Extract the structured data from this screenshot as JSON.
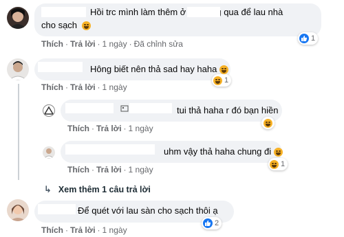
{
  "comments": [
    {
      "text": "Hồi trc mình làm thêm ở       . Khiêng qua để lau nhà",
      "text2": "cho sạch",
      "actions": [
        "Thích",
        "Trả lời",
        "1 ngày",
        "Đã chỉnh sửa"
      ],
      "reaction": {
        "type": "like-icon",
        "count": "1"
      }
    },
    {
      "text": "Hông biết nên thả sad hay haha",
      "actions": [
        "Thích",
        "Trả lời",
        "1 ngày"
      ],
      "reaction": {
        "type": "haha-icon",
        "count": "1"
      }
    },
    {
      "text": "tui thả haha r đó bạn hiền",
      "actions": [
        "Thích",
        "Trả lời",
        "1 ngày"
      ],
      "reaction": {
        "type": "haha-icon",
        "count": ""
      }
    },
    {
      "text": "uhm vậy thả haha chung đi",
      "actions": [
        "Thích",
        "Trả lời",
        "1 ngày"
      ],
      "reaction": {
        "type": "haha-icon",
        "count": "1"
      }
    },
    {
      "text": "Để quét với lau sàn cho sạch thôi ạ",
      "actions": [
        "Thích",
        "Trả lời",
        "1 ngày"
      ],
      "reaction": {
        "type": "like-icon",
        "count": "2"
      }
    }
  ],
  "view_more": "Xem thêm 1 câu trả lời",
  "colors": {
    "bubble": "#f0f2f5",
    "meta": "#65676b",
    "like": "#1877f2",
    "haha": "#f7b125"
  }
}
